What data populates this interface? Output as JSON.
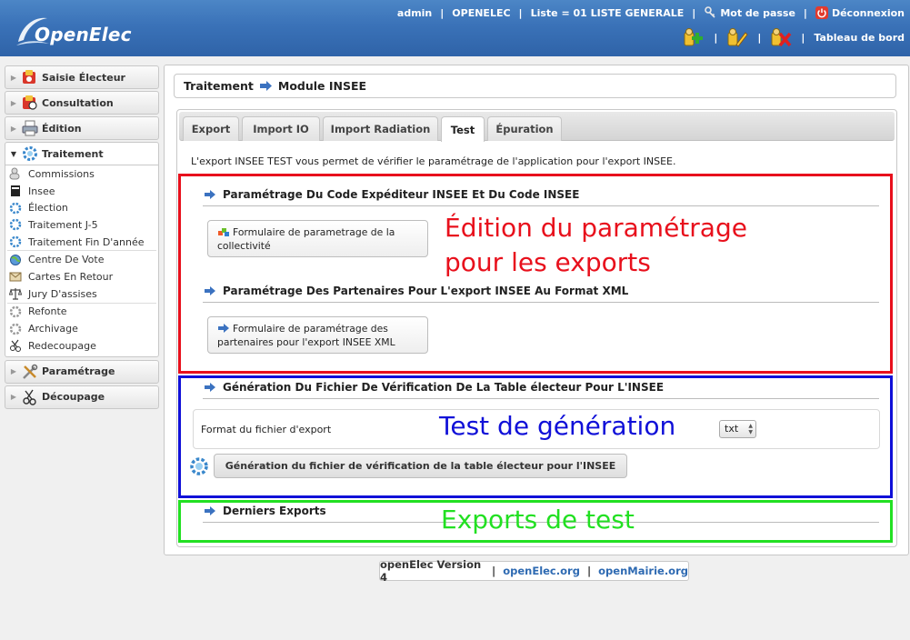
{
  "app": {
    "logo_text": "OpenElec"
  },
  "topnav": {
    "user": "admin",
    "instance": "OPENELEC",
    "list": "Liste = 01 LISTE GENERALE",
    "password": "Mot de passe",
    "logout": "Déconnexion",
    "separator": "|"
  },
  "toolbar": {
    "dashboard": "Tableau de bord",
    "separator": "|"
  },
  "sidebar": {
    "sections": [
      {
        "label": "Saisie Électeur",
        "icon": "voter-entry-icon"
      },
      {
        "label": "Consultation",
        "icon": "consultation-icon"
      },
      {
        "label": "Édition",
        "icon": "printer-icon"
      },
      {
        "label": "Traitement",
        "icon": "gear-icon"
      },
      {
        "label": "Paramétrage",
        "icon": "tools-icon"
      },
      {
        "label": "Découpage",
        "icon": "scissors-icon"
      }
    ],
    "traitement_items": [
      {
        "label": "Commissions",
        "icon": "people-icon"
      },
      {
        "label": "Insee",
        "icon": "insee-icon"
      },
      {
        "label": "Élection",
        "icon": "gear-icon"
      },
      {
        "label": "Traitement J-5",
        "icon": "gear-icon"
      },
      {
        "label": "Traitement Fin D'année",
        "icon": "gear-icon"
      },
      {
        "label": "Centre De Vote",
        "icon": "globe-icon"
      },
      {
        "label": "Cartes En Retour",
        "icon": "mail-icon"
      },
      {
        "label": "Jury D'assises",
        "icon": "scales-icon"
      },
      {
        "label": "Refonte",
        "icon": "gear-grey-icon"
      },
      {
        "label": "Archivage",
        "icon": "gear-grey-icon"
      },
      {
        "label": "Redecoupage",
        "icon": "scissors-icon"
      }
    ]
  },
  "breadcrumb": {
    "parent": "Traitement",
    "current": "Module INSEE"
  },
  "tabs": [
    {
      "label": "Export"
    },
    {
      "label": "Import IO"
    },
    {
      "label": "Import Radiation"
    },
    {
      "label": "Test"
    },
    {
      "label": "Épuration"
    }
  ],
  "active_tab": "Test",
  "content": {
    "intro": "L'export INSEE TEST vous permet de vérifier le paramétrage de l'application pour l'export INSEE.",
    "section1_title": "Paramétrage Du Code Expéditeur INSEE Et Du Code INSEE",
    "section1_button": "Formulaire de parametrage de la collectivité",
    "section2_title": "Paramétrage Des Partenaires Pour L'export INSEE Au Format XML",
    "section2_button": "Formulaire de paramétrage des partenaires pour l'export INSEE XML",
    "section3_title": "Génération Du Fichier De Vérification De La Table électeur Pour L'INSEE",
    "format_label": "Format du fichier d'export",
    "format_value": "txt",
    "generate_button": "Génération du fichier de vérification de la table électeur pour l'INSEE",
    "section4_title": "Derniers Exports"
  },
  "annotations": {
    "edition": [
      "Édition du paramétrage",
      "pour les exports"
    ],
    "test": "Test de génération",
    "exports": "Exports de test",
    "colors": {
      "red": "#e8101c",
      "blue": "#1010d8",
      "green": "#22e022"
    }
  },
  "footer": {
    "version": "openElec Version 4",
    "link1": "openElec.org",
    "link2": "openMairie.org",
    "separator": "|"
  },
  "colors": {
    "header_blue": "#3a72b8",
    "link_blue": "#2e6ab2"
  }
}
